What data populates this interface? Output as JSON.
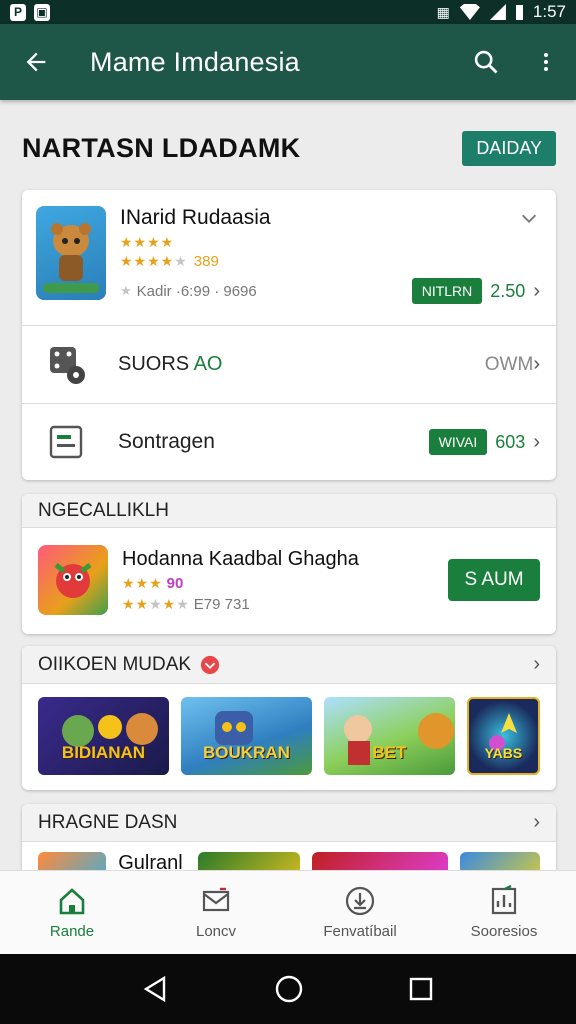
{
  "status_bar": {
    "time": "1:57"
  },
  "app_bar": {
    "title": "Mame Imdanesia"
  },
  "page": {
    "title": "NARTASN LDADAMK",
    "day_button": "DAIDAY"
  },
  "featured": {
    "app": {
      "name": "INarid Rudaasia",
      "rating_value": "389",
      "meta": "Kadir ·6:99 · 9696",
      "badge": "NITLRN",
      "value": "2.50"
    },
    "rows": [
      {
        "label_a": "SUORS",
        "label_b": "AO",
        "right": "OWM"
      },
      {
        "label": "Sontragen",
        "badge": "WIVAI",
        "value": "603"
      }
    ]
  },
  "section_general": {
    "title": "NGECALLIKLH",
    "app": {
      "name": "Hodanna Kaadbal Ghagha",
      "rating_value": "90",
      "meta": "E79 731",
      "button": "S AUM"
    }
  },
  "section_oikoen": {
    "title": "OIIKOEN MUDAK",
    "tiles": [
      {
        "label": "BIDIANAN",
        "bg": "#2b2a6b"
      },
      {
        "label": "BOUKRAN",
        "bg": "#3a8ec9"
      },
      {
        "label": "BET",
        "bg": "#8ccf5a"
      },
      {
        "label": "YABS",
        "bg": "#1a2a5c"
      }
    ]
  },
  "section_hragne": {
    "title": "HRAGNE DASN",
    "label": "Gulranl"
  },
  "bottom_nav": [
    {
      "label": "Rande",
      "icon": "home-icon",
      "active": true
    },
    {
      "label": "Loncv",
      "icon": "mail-icon",
      "active": false
    },
    {
      "label": "Fenvatíbail",
      "icon": "download-icon",
      "active": false
    },
    {
      "label": "Sooresios",
      "icon": "chart-icon",
      "active": false
    }
  ],
  "colors": {
    "primary": "#1e5747",
    "accent": "#1a7f3c",
    "status_bar": "#0c2f27",
    "star": "#e8a11a"
  }
}
